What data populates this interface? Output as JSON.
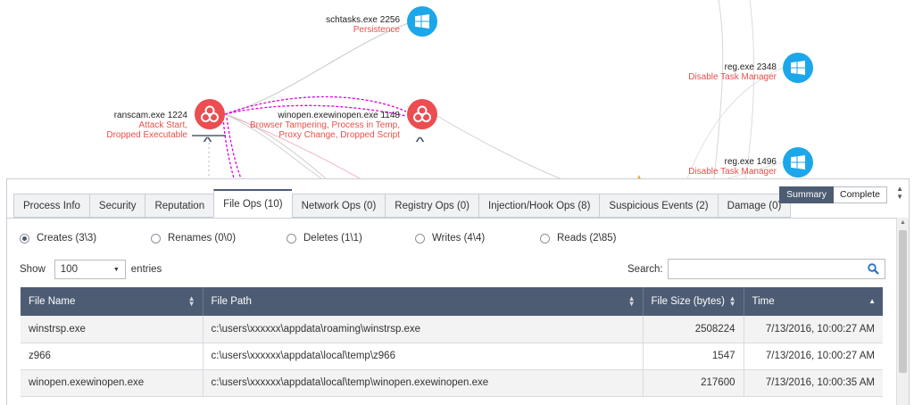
{
  "graph": {
    "nodes": [
      {
        "name": "schtasks.exe 2256",
        "tags": "Persistence",
        "icon": "windows-icon"
      },
      {
        "name": "reg.exe 2348",
        "tags": "Disable Task Manager",
        "icon": "windows-icon"
      },
      {
        "name": "ranscam.exe 1224",
        "tags_line1": "Attack Start,",
        "tags_line2": "Dropped Executable",
        "icon": "biohazard-icon"
      },
      {
        "name": "winopen.exewinopen.exe 1148",
        "tags_line1": "Browser Tampering, Process in Temp,",
        "tags_line2": "Proxy Change, Dropped Script",
        "icon": "biohazard-icon"
      },
      {
        "name": "reg.exe 1496",
        "tags": "Disable Task Manager",
        "icon": "windows-icon"
      }
    ]
  },
  "panel": {
    "tabs": [
      {
        "label": "Process Info"
      },
      {
        "label": "Security"
      },
      {
        "label": "Reputation"
      },
      {
        "label": "File Ops (10)"
      },
      {
        "label": "Network Ops (0)"
      },
      {
        "label": "Registry Ops (0)"
      },
      {
        "label": "Injection/Hook Ops (8)"
      },
      {
        "label": "Suspicious Events (2)"
      },
      {
        "label": "Damage (0)"
      }
    ],
    "active_tab": "File Ops (10)",
    "view_toggle": {
      "summary": "Summary",
      "complete": "Complete",
      "selected": "Summary"
    },
    "radios": [
      {
        "label": "Creates (3\\3)",
        "selected": true
      },
      {
        "label": "Renames (0\\0)",
        "selected": false
      },
      {
        "label": "Deletes (1\\1)",
        "selected": false
      },
      {
        "label": "Writes (4\\4)",
        "selected": false
      },
      {
        "label": "Reads (2\\85)",
        "selected": false
      }
    ],
    "show_label": "Show",
    "entries_value": "100",
    "entries_label": "entries",
    "search_label": "Search:",
    "search_value": "",
    "table": {
      "headers": [
        "File Name",
        "File Path",
        "File Size (bytes)",
        "Time"
      ],
      "rows": [
        [
          "winstrsp.exe",
          "c:\\users\\xxxxxx\\appdata\\roaming\\winstrsp.exe",
          "2508224",
          "7/13/2016, 10:00:27 AM"
        ],
        [
          "z966",
          "c:\\users\\xxxxxx\\appdata\\local\\temp\\z966",
          "1547",
          "7/13/2016, 10:00:27 AM"
        ],
        [
          "winopen.exewinopen.exe",
          "c:\\users\\xxxxxx\\appdata\\local\\temp\\winopen.exewinopen.exe",
          "217600",
          "7/13/2016, 10:00:35 AM"
        ]
      ]
    }
  },
  "colors": {
    "header": "#4d5c73",
    "windows_node": "#1ca7ea",
    "malicious_node": "#ec4d51",
    "tag_text": "#e5514a",
    "edge_pink": "#e000e0"
  }
}
